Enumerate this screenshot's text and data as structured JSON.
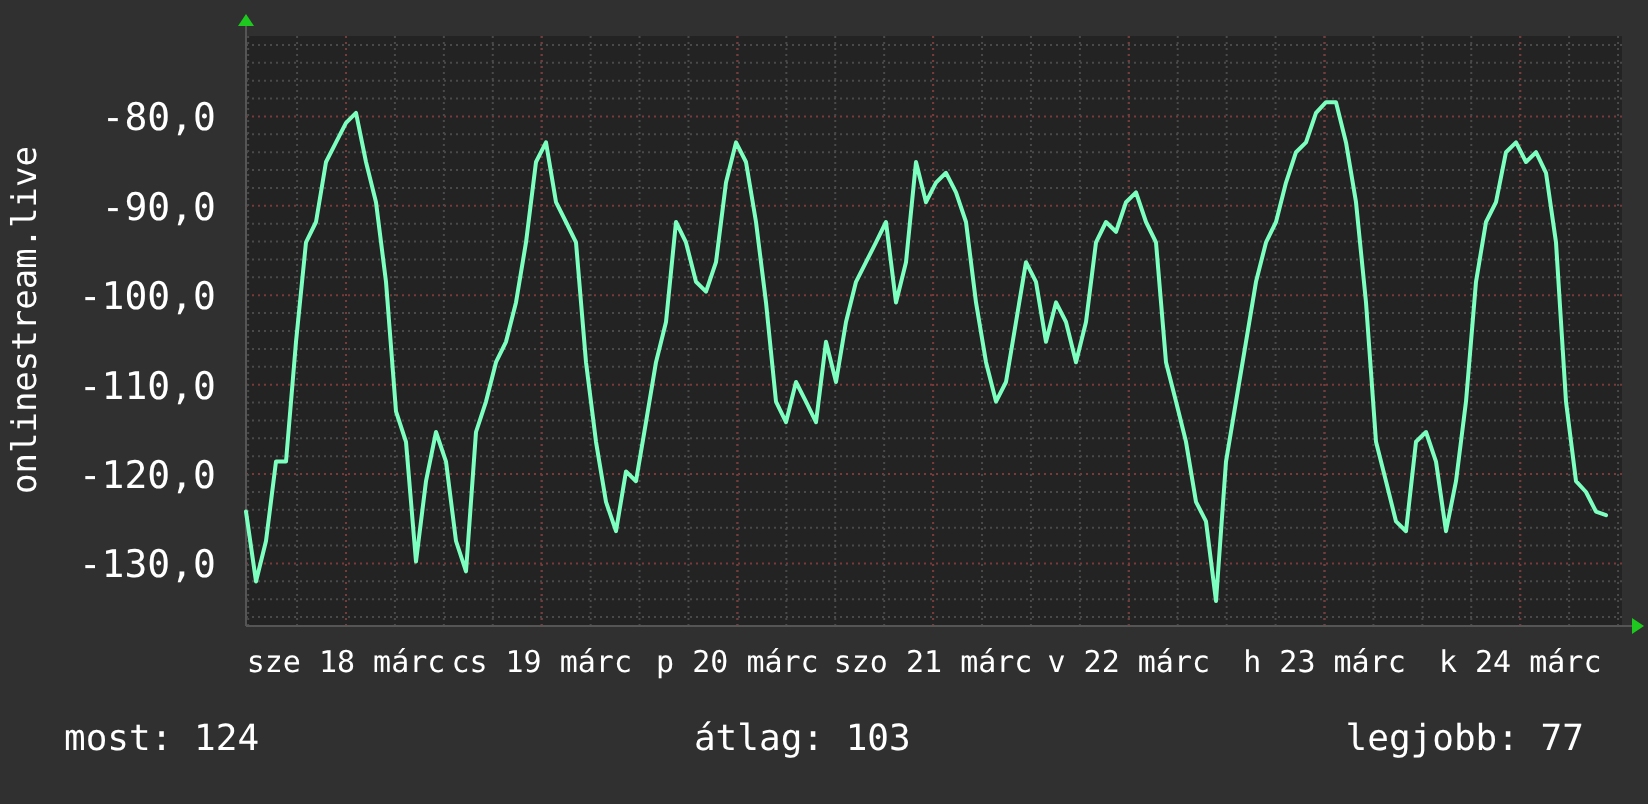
{
  "chart": {
    "x_labels": [
      "sze 18 márc",
      "cs 19 márc",
      "p 20 márc",
      "szo 21 márc",
      "v 22 márc",
      "h 23 márc",
      "k 24 márc"
    ],
    "chart_data": {
      "type": "line",
      "ylabel": "onlinestream.live",
      "grid": true,
      "ylim": [
        -137,
        -71
      ],
      "yticks": [
        {
          "value": -130,
          "label": "-130,0"
        },
        {
          "value": -120,
          "label": "-120,0"
        },
        {
          "value": -110,
          "label": "-110,0"
        },
        {
          "value": -100,
          "label": "-100,0"
        },
        {
          "value": -90,
          "label": "-90,0"
        },
        {
          "value": -80,
          "label": "-80,0"
        }
      ],
      "series": [
        {
          "color": "#7dffc0",
          "values": [
            -124.2,
            -132,
            -127.5,
            -118.6,
            -118.6,
            -105.2,
            -94.1,
            -91.8,
            -85.1,
            -82.9,
            -80.7,
            -79.6,
            -85.1,
            -89.6,
            -98.5,
            -113,
            -116.4,
            -129.8,
            -120.8,
            -115.3,
            -118.6,
            -127.5,
            -130.9,
            -115.3,
            -111.9,
            -107.5,
            -105.2,
            -100.8,
            -94.1,
            -85.1,
            -82.9,
            -89.6,
            -91.8,
            -94.1,
            -107.5,
            -116.4,
            -123.1,
            -126.4,
            -119.7,
            -120.8,
            -114.2,
            -107.5,
            -103,
            -91.8,
            -94.1,
            -98.5,
            -99.6,
            -96.3,
            -87.4,
            -82.9,
            -85.1,
            -91.8,
            -100.8,
            -111.9,
            -114.2,
            -109.7,
            -111.9,
            -114.2,
            -105.2,
            -109.7,
            -103,
            -98.5,
            -96.3,
            -94.1,
            -91.8,
            -100.8,
            -96.3,
            -85.1,
            -89.6,
            -87.4,
            -86.3,
            -88.5,
            -91.8,
            -100.8,
            -107.5,
            -111.9,
            -109.7,
            -103,
            -96.3,
            -98.5,
            -105.2,
            -100.8,
            -103,
            -107.5,
            -103,
            -94.1,
            -91.8,
            -92.9,
            -89.6,
            -88.5,
            -91.8,
            -94.1,
            -107.5,
            -111.9,
            -116.4,
            -123.1,
            -125.3,
            -134.2,
            -118.6,
            -111.9,
            -105.2,
            -98.5,
            -94.1,
            -91.8,
            -87.4,
            -84,
            -82.9,
            -79.6,
            -78.4,
            -78.4,
            -82.9,
            -89.6,
            -100.8,
            -116.4,
            -120.8,
            -125.3,
            -126.4,
            -116.4,
            -115.3,
            -118.6,
            -126.4,
            -120.8,
            -111.9,
            -98.5,
            -91.8,
            -89.6,
            -84,
            -82.9,
            -85.1,
            -84,
            -86.3,
            -94.1,
            -111.9,
            -120.8,
            -122,
            -124.2,
            -124.6
          ]
        }
      ]
    }
  },
  "summary": [
    {
      "label": "most: 124"
    },
    {
      "label": "átlag: 103"
    },
    {
      "label": "legjobb: 77"
    }
  ]
}
